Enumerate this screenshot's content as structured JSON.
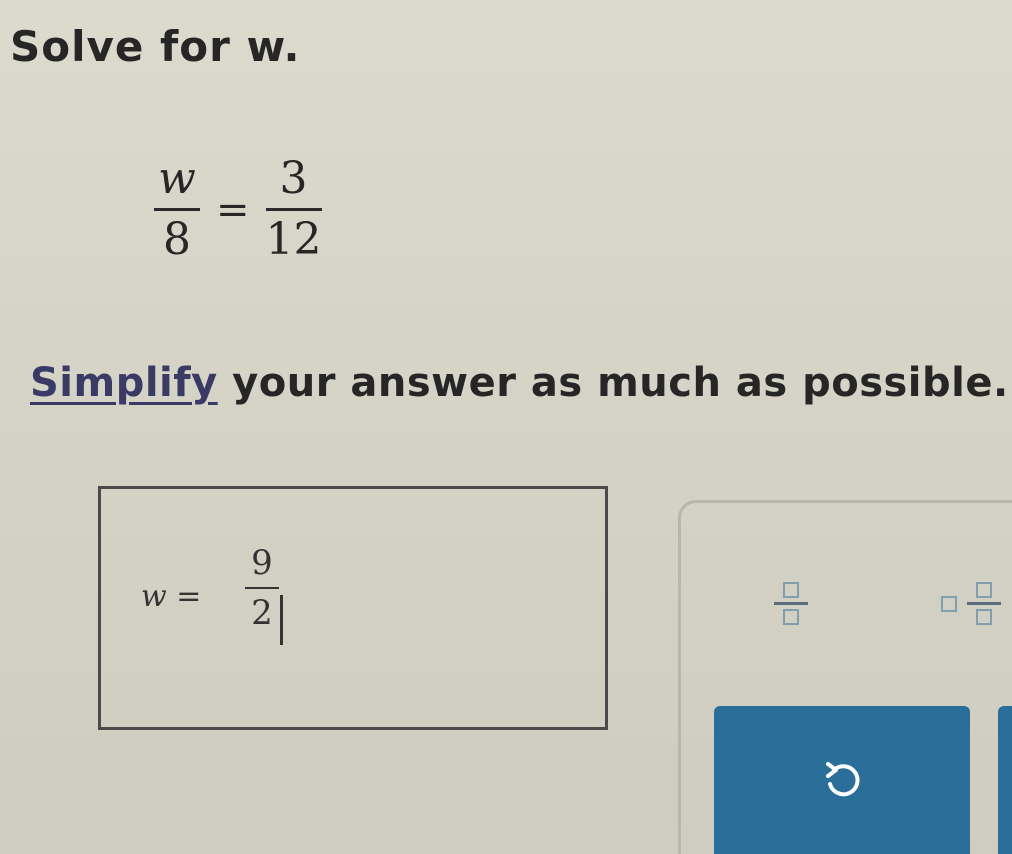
{
  "problem": {
    "prompt": "Solve for w.",
    "equation": {
      "left": {
        "numerator": "w",
        "denominator": "8"
      },
      "operator": "=",
      "right": {
        "numerator": "3",
        "denominator": "12"
      }
    },
    "instruction_link": "Simplify",
    "instruction_rest": " your answer as much as possible."
  },
  "answer": {
    "variable_label": "w =",
    "numerator": "9",
    "denominator": "2"
  },
  "toolbar": {
    "fraction_icon": "fraction-template-icon",
    "mixed_number_icon": "mixed-number-template-icon",
    "undo_icon": "undo-icon"
  },
  "colors": {
    "background": "#d3d1c3",
    "text": "#262626",
    "button": "#2a6e9a",
    "icon_outline": "#7f9fae"
  }
}
